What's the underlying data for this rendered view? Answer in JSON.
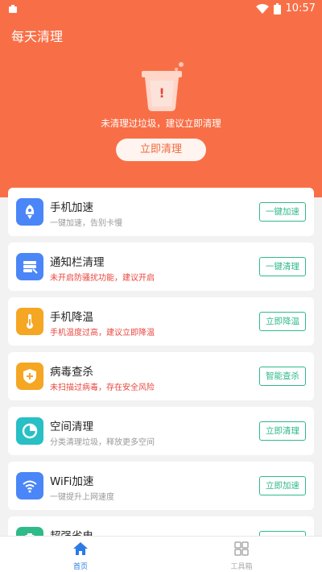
{
  "status_bar": {
    "time": "10:57"
  },
  "app": {
    "title": "每天清理"
  },
  "hero": {
    "message": "未清理过垃圾，建议立即清理",
    "button_label": "立即清理",
    "trash_mark": "!"
  },
  "features": [
    {
      "icon": "rocket-icon",
      "icon_color": "#4a86f7",
      "title": "手机加速",
      "subtitle": "一键加速，告别卡慢",
      "subtitle_type": "normal",
      "action": "一键加速"
    },
    {
      "icon": "notification-icon",
      "icon_color": "#4a86f7",
      "title": "通知栏清理",
      "subtitle": "未开启防骚扰功能，建议开启",
      "subtitle_type": "warn",
      "action": "一键清理"
    },
    {
      "icon": "thermometer-icon",
      "icon_color": "#f5a623",
      "title": "手机降温",
      "subtitle": "手机温度过高，建议立即降温",
      "subtitle_type": "warn",
      "action": "立即降温"
    },
    {
      "icon": "shield-icon",
      "icon_color": "#f5a623",
      "title": "病毒查杀",
      "subtitle": "未扫描过病毒，存在安全风险",
      "subtitle_type": "warn",
      "action": "智能查杀"
    },
    {
      "icon": "pie-chart-icon",
      "icon_color": "#28bfc5",
      "title": "空间清理",
      "subtitle": "分类清理垃圾，释放更多空间",
      "subtitle_type": "normal",
      "action": "立即清理"
    },
    {
      "icon": "wifi-icon",
      "icon_color": "#4a86f7",
      "title": "WiFi加速",
      "subtitle": "一键提升上网速度",
      "subtitle_type": "normal",
      "action": "立即加速"
    },
    {
      "icon": "battery-icon",
      "icon_color": "#2fba89",
      "title": "超强省电",
      "subtitle": "",
      "subtitle_type": "normal",
      "action": ""
    }
  ],
  "tabbar": {
    "home_label": "首页",
    "tools_label": "工具箱"
  },
  "colors": {
    "brand": "#f86f47",
    "action_green": "#2fba89",
    "warn_red": "#e8463e",
    "tab_active": "#2c7be5"
  }
}
